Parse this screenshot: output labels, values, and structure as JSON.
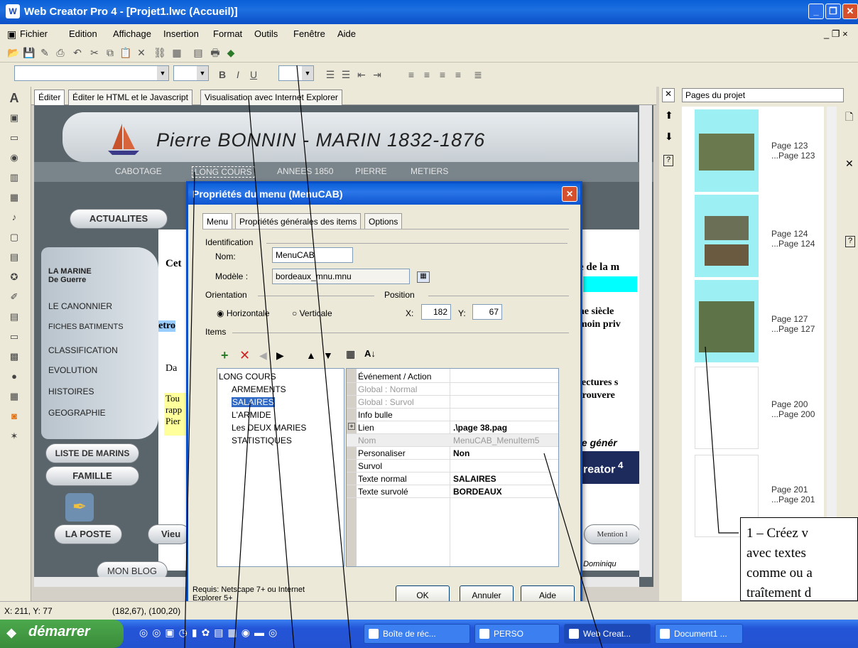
{
  "window": {
    "title": "Web Creator Pro 4 - [Projet1.lwc (Accueil)]"
  },
  "menubar": [
    "Fichier",
    "Edition",
    "Affichage",
    "Insertion",
    "Format",
    "Outils",
    "Fenêtre",
    "Aide"
  ],
  "editor_tabs": [
    "Éditer",
    "Éditer le HTML et le Javascript",
    "Visualisation avec Internet Explorer"
  ],
  "page": {
    "banner_title": "Pierre BONNIN - MARIN 1832-1876",
    "nav": [
      "CABOTAGE",
      "LONG COURS",
      "ANNEES 1850",
      "PIERRE",
      "METIERS"
    ],
    "buttons": {
      "actualites": "ACTUALITES",
      "liste": "LISTE DE MARINS",
      "famille": "FAMILLE",
      "poste": "LA POSTE",
      "vieu": "Vieu",
      "blog": "MON BLOG"
    },
    "sidebar_title": "LA MARINE",
    "sidebar_sub": "De Guerre",
    "sidebar": [
      "LE CANONNIER",
      "FICHES BATIMENTS",
      "CLASSIFICATION",
      "EVOLUTION",
      "HISTOIRES",
      "GEOGRAPHIE"
    ],
    "snippets": {
      "cet": "Cet",
      "retro": "Retro",
      "da": "Da",
      "tou": "Tou",
      "rapp": "rapp",
      "pier": "Pier",
      "delam": "e de la m",
      "siecle": "ne siècle",
      "moin": "moin priv",
      "lectures": "lectures s",
      "trouvere": "trouvere",
      "legener": "le génér",
      "creator": "reator",
      "mention": "Mention l",
      "domin": ": Dominiqu"
    }
  },
  "dialog": {
    "title": "Propriétés du menu (MenuCAB)",
    "tabs": [
      "Menu",
      "Propriétés générales des items",
      "Options"
    ],
    "identification": "Identification",
    "nom_label": "Nom:",
    "nom_value": "MenuCAB",
    "modele_label": "Modèle :",
    "modele_value": "bordeaux_mnu.mnu",
    "orientation": "Orientation",
    "horizontale": "Horizontale",
    "verticale": "Verticale",
    "position": "Position",
    "x_label": "X:",
    "x_value": "182",
    "y_label": "Y:",
    "y_value": "67",
    "items": "Items",
    "tree": [
      "LONG COURS",
      "ARMEMENTS",
      "SALAIRES",
      "L'ARMIDE",
      "Les DEUX MARIES",
      "STATISTIQUES"
    ],
    "props": [
      {
        "k": "Événement / Action",
        "v": ""
      },
      {
        "k": "Global : Normal",
        "v": ""
      },
      {
        "k": "Global : Survol",
        "v": ""
      },
      {
        "k": "Info bulle",
        "v": ""
      },
      {
        "k": "Lien",
        "v": ".\\page 38.pag"
      },
      {
        "k": "Nom",
        "v": "MenuCAB_MenuItem5"
      },
      {
        "k": "Personaliser",
        "v": "Non"
      },
      {
        "k": "Survol",
        "v": ""
      },
      {
        "k": "Texte normal",
        "v": "SALAIRES"
      },
      {
        "k": "Texte survolé",
        "v": "BORDEAUX"
      }
    ],
    "requis": "Requis: Netscape 7+ ou Internet Explorer 5+",
    "ok": "OK",
    "annuler": "Annuler",
    "aide": "Aide"
  },
  "right": {
    "title": "Pages du projet",
    "pages": [
      {
        "a": "Page 123",
        "b": "...Page 123"
      },
      {
        "a": "Page 124",
        "b": "...Page 124"
      },
      {
        "a": "Page 127",
        "b": "...Page 127"
      },
      {
        "a": "Page 200",
        "b": "...Page 200"
      },
      {
        "a": "Page 201",
        "b": "...Page 201"
      }
    ]
  },
  "status": {
    "coords": "X: 211, Y: 77",
    "size": "(182,67), (100,20)"
  },
  "taskbar": {
    "start": "démarrer",
    "tasks": [
      "Boîte de réc...",
      "PERSO",
      "Web Creat...",
      "Document1 ..."
    ]
  },
  "callout": {
    "l1": "1 – Créez v",
    "l2": "avec textes",
    "l3": "comme ou a",
    "l4": "traîtement d"
  }
}
